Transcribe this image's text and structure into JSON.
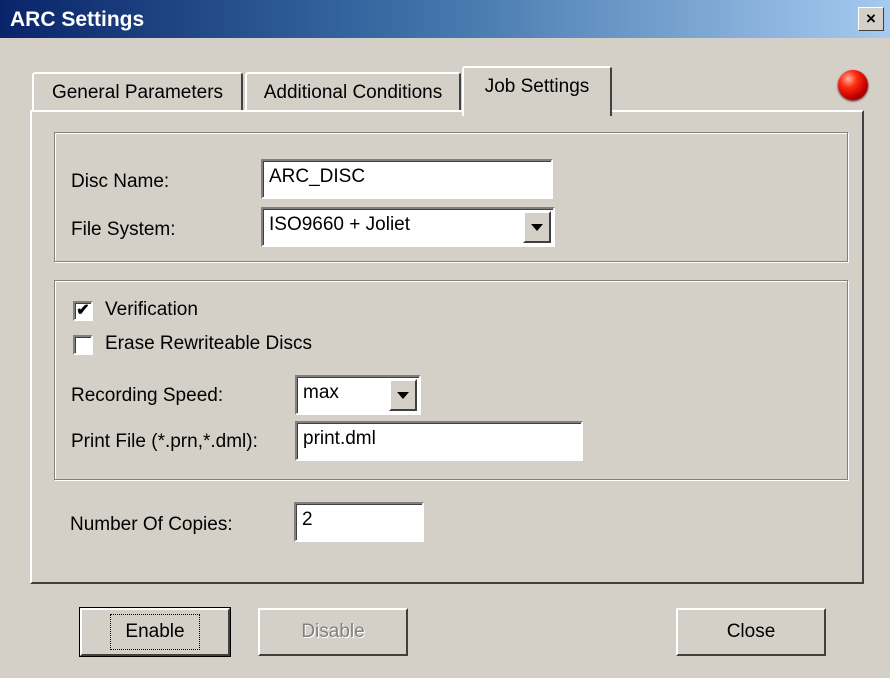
{
  "window": {
    "title": "ARC Settings",
    "close_label": "×"
  },
  "tabs": [
    {
      "label": "General Parameters",
      "active": false
    },
    {
      "label": "Additional Conditions",
      "active": false
    },
    {
      "label": "Job Settings",
      "active": true
    }
  ],
  "status_led": {
    "color": "#e01010",
    "icon": "red-status-led"
  },
  "disc_group": {
    "disc_name_label": "Disc Name:",
    "disc_name_value": "ARC_DISC",
    "file_system_label": "File System:",
    "file_system_value": "ISO9660 + Joliet"
  },
  "options_group": {
    "verification_label": "Verification",
    "verification_checked": true,
    "erase_label": "Erase Rewriteable Discs",
    "erase_checked": false,
    "recording_speed_label": "Recording Speed:",
    "recording_speed_value": "max",
    "print_file_label": "Print File (*.prn,*.dml):",
    "print_file_value": "print.dml"
  },
  "copies": {
    "label": "Number Of Copies:",
    "value": "2"
  },
  "buttons": {
    "enable": "Enable",
    "disable": "Disable",
    "close": "Close"
  }
}
